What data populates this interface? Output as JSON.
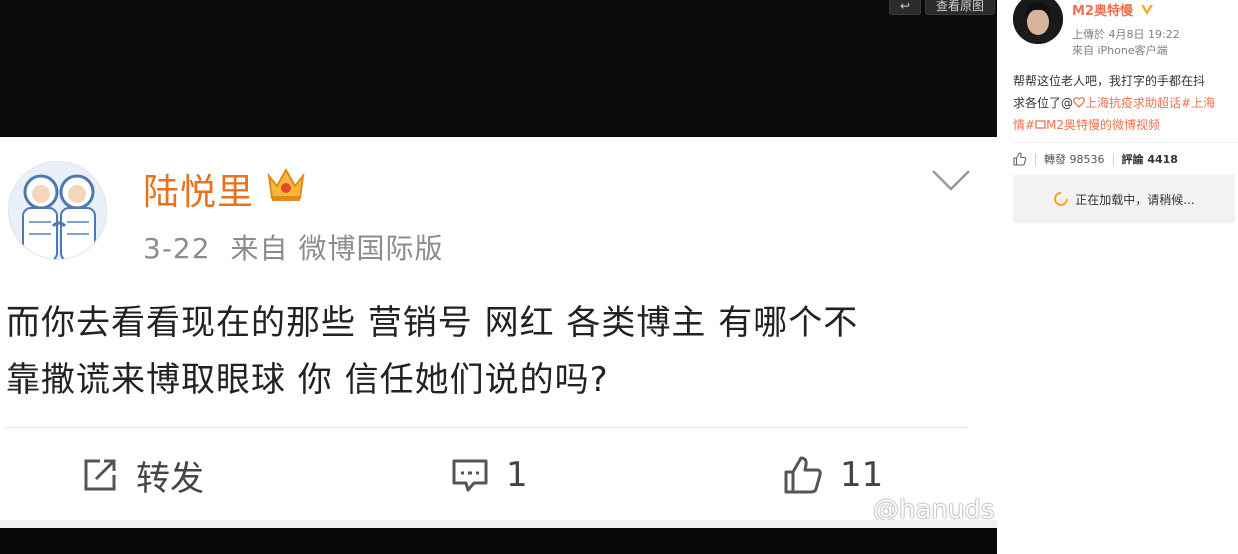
{
  "viewer": {
    "buttons": [
      {
        "label": "↩"
      },
      {
        "label": "查看原图"
      }
    ]
  },
  "post": {
    "username": "陆悦里",
    "date": "3-22",
    "source": "来自 微博国际版",
    "text_lines": [
      "而你去看看现在的那些 营销号 网红 各类博主 有哪个不",
      "靠撒谎来博取眼球 你 信任她们说的吗?"
    ],
    "actions": {
      "repost_label": "转发",
      "comment_count": "1",
      "like_count": "11"
    },
    "watermark": "@hanuds"
  },
  "side": {
    "username": "M2奥特慢",
    "time": "上傳於 4月8日 19:22",
    "source": "來自 iPhone客户端",
    "text": {
      "line1": "帮帮这位老人吧，我打字的手都在抖",
      "line2_prefix": "求各位了@",
      "line2_topic": "上海抗疫求助超话",
      "line2_tag": "#上海",
      "line3_prefix": "情#",
      "line3_link": "M2奥特慢的微博视频"
    },
    "stats": {
      "repost_label": "轉發",
      "repost_count": "98536",
      "comment_label": "評論",
      "comment_count": "4418"
    },
    "loading_text": "正在加载中，请稍候..."
  },
  "colors": {
    "accent_orange": "#e8731f",
    "weibo_orange": "#eb7350",
    "text_dark": "#222222",
    "text_gray": "#8c8c8c"
  },
  "icons": [
    "crown-icon",
    "chevron-down-icon",
    "repost-icon",
    "comment-icon",
    "like-icon",
    "weibo-logo-icon",
    "verified-icon",
    "heart-icon",
    "spinner-icon",
    "thumb-up-icon"
  ]
}
